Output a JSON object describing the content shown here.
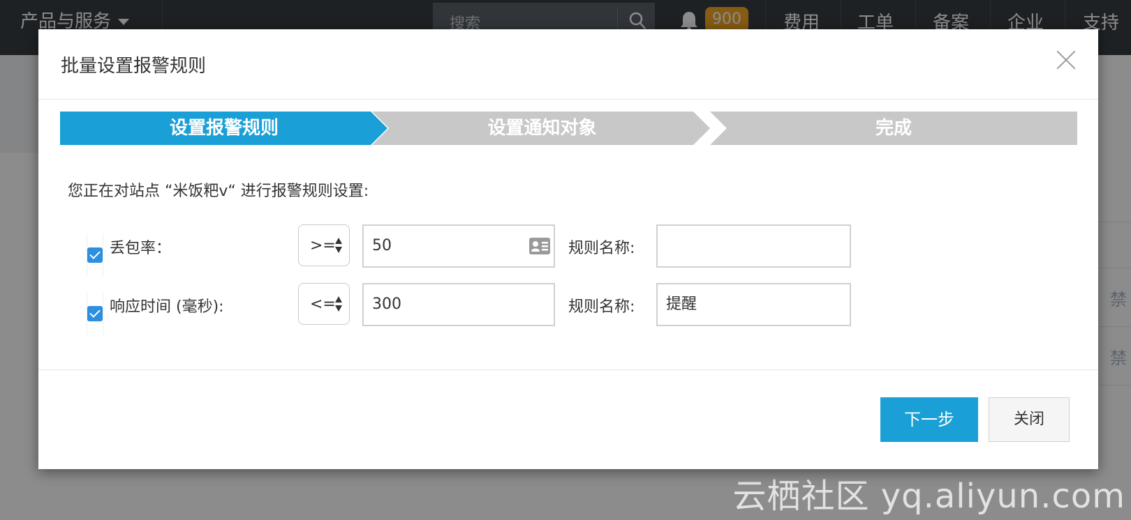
{
  "topbar": {
    "products_label": "产品与服务",
    "search_placeholder": "搜索",
    "notification_count": "900",
    "nav": [
      "费用",
      "工单",
      "备案",
      "企业",
      "支持"
    ]
  },
  "background": {
    "row_text": "禁"
  },
  "dialog": {
    "title": "批量设置报警规则",
    "steps": [
      "设置报警规则",
      "设置通知对象",
      "完成"
    ],
    "intro": "您正在对站点 “米饭粑v“ 进行报警规则设置:",
    "rules": [
      {
        "checked": true,
        "metric": "丢包率：",
        "operator": ">=",
        "value": "50",
        "name_label": "规则名称:",
        "name_value": ""
      },
      {
        "checked": true,
        "metric": "响应时间 (毫秒):",
        "operator": "<=",
        "value": "300",
        "name_label": "规则名称:",
        "name_value": "提醒"
      }
    ],
    "next_button": "下一步",
    "close_button": "关闭"
  },
  "watermark": "云栖社区 yq.aliyun.com",
  "colors": {
    "step_active": "#1a9fd6",
    "step_inactive": "#c8c8c8",
    "primary_button": "#1a9fd6",
    "checkbox": "#2d8fe0",
    "badge": "#f5a623"
  }
}
